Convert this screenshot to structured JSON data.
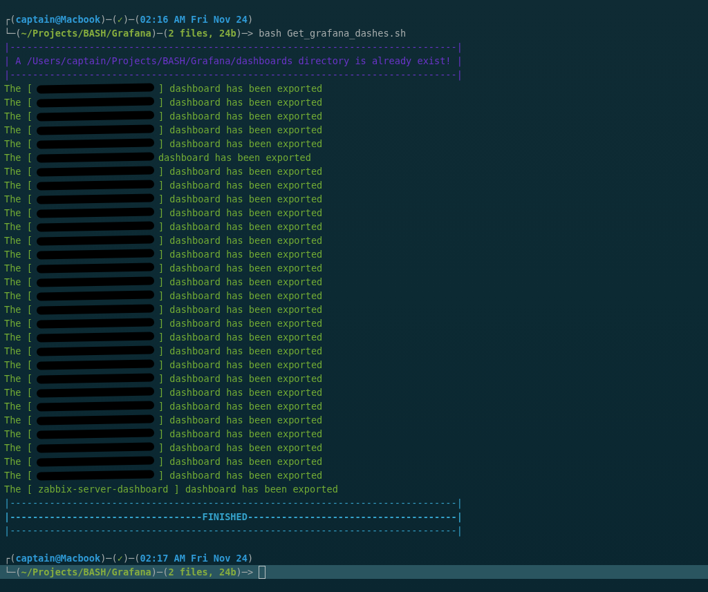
{
  "prompts": [
    {
      "line_1": [
        {
          "kind": "punct",
          "text": "┌("
        },
        {
          "kind": "host",
          "text": "captain@Macbook"
        },
        {
          "kind": "punct",
          "text": ")─("
        },
        {
          "kind": "status",
          "text": "✓"
        },
        {
          "kind": "punct",
          "text": ")─("
        },
        {
          "kind": "host",
          "text": "02:16 AM Fri Nov 24"
        },
        {
          "kind": "punct",
          "text": ")"
        }
      ],
      "line_2": [
        {
          "kind": "punct",
          "text": "└─("
        },
        {
          "kind": "path",
          "text": "~/Projects/BASH/Grafana"
        },
        {
          "kind": "punct",
          "text": ")─("
        },
        {
          "kind": "path",
          "text": "2 files, 24b"
        },
        {
          "kind": "punct",
          "text": ")─>"
        },
        {
          "kind": "command",
          "text": " bash Get_grafana_dashes.sh"
        }
      ]
    }
  ],
  "notice_box": {
    "border_top": "|-------------------------------------------------------------------------------|",
    "message": "| A /Users/captain/Projects/BASH/Grafana/dashboards directory is already exist! |",
    "border_bottom": "|-------------------------------------------------------------------------------|"
  },
  "exports": [
    {
      "before": "The [",
      "redacted": true,
      "after": "] dashboard has been exported"
    },
    {
      "before": "The [",
      "redacted": true,
      "after": "] dashboard has been exported"
    },
    {
      "before": "The [",
      "redacted": true,
      "after": "] dashboard has been exported"
    },
    {
      "before": "The [",
      "redacted": true,
      "after": "] dashboard has been exported"
    },
    {
      "before": "The [",
      "redacted": true,
      "after": "] dashboard has been exported"
    },
    {
      "before": "The [",
      "redacted": true,
      "after": "dashboard has been exported"
    },
    {
      "before": "The [",
      "redacted": true,
      "after": "] dashboard has been exported"
    },
    {
      "before": "The [",
      "redacted": true,
      "after": "] dashboard has been exported"
    },
    {
      "before": "The [",
      "redacted": true,
      "after": "] dashboard has been exported"
    },
    {
      "before": "The [",
      "redacted": true,
      "after": "] dashboard has been exported"
    },
    {
      "before": "The [",
      "redacted": true,
      "after": "] dashboard has been exported"
    },
    {
      "before": "The [",
      "redacted": true,
      "after": "] dashboard has been exported"
    },
    {
      "before": "The [",
      "redacted": true,
      "after": "] dashboard has been exported"
    },
    {
      "before": "The [",
      "redacted": true,
      "after": "] dashboard has been exported"
    },
    {
      "before": "The [",
      "redacted": true,
      "after": "] dashboard has been exported"
    },
    {
      "before": "The [",
      "redacted": true,
      "after": "] dashboard has been exported"
    },
    {
      "before": "The [",
      "redacted": true,
      "after": "] dashboard has been exported"
    },
    {
      "before": "The [",
      "redacted": true,
      "after": "] dashboard has been exported"
    },
    {
      "before": "The [",
      "redacted": true,
      "after": "] dashboard has been exported"
    },
    {
      "before": "The [",
      "redacted": true,
      "after": "] dashboard has been exported"
    },
    {
      "before": "The [",
      "redacted": true,
      "after": "] dashboard has been exported"
    },
    {
      "before": "The [",
      "redacted": true,
      "after": "] dashboard has been exported"
    },
    {
      "before": "The [",
      "redacted": true,
      "after": "] dashboard has been exported"
    },
    {
      "before": "The [",
      "redacted": true,
      "after": "] dashboard has been exported"
    },
    {
      "before": "The [",
      "redacted": true,
      "after": "] dashboard has been exported"
    },
    {
      "before": "The [",
      "redacted": true,
      "after": "] dashboard has been exported"
    },
    {
      "before": "The [",
      "redacted": true,
      "after": "] dashboard has been exported"
    },
    {
      "before": "The [",
      "redacted": true,
      "after": "] dashboard has been exported"
    },
    {
      "before": "The [",
      "redacted": true,
      "after": "] dashboard has been exported"
    },
    {
      "before": "The [",
      "redacted": false,
      "name": "zabbix-server-dashboard",
      "after": "] dashboard has been exported"
    }
  ],
  "finished_box": {
    "border_top": "|-------------------------------------------------------------------------------|",
    "message": "|----------------------------------FINISHED-------------------------------------|",
    "border_bottom": "|-------------------------------------------------------------------------------|"
  },
  "final_prompt": {
    "line_1": [
      {
        "kind": "punct",
        "text": "┌("
      },
      {
        "kind": "host",
        "text": "captain@Macbook"
      },
      {
        "kind": "punct",
        "text": ")─("
      },
      {
        "kind": "status",
        "text": "✓"
      },
      {
        "kind": "punct",
        "text": ")─("
      },
      {
        "kind": "host",
        "text": "02:17 AM Fri Nov 24"
      },
      {
        "kind": "punct",
        "text": ")"
      }
    ],
    "line_2": [
      {
        "kind": "punct",
        "text": "└─("
      },
      {
        "kind": "path",
        "text": "~/Projects/BASH/Grafana"
      },
      {
        "kind": "punct",
        "text": ")─("
      },
      {
        "kind": "path",
        "text": "2 files, 24b"
      },
      {
        "kind": "punct",
        "text": ")─>"
      }
    ],
    "current_line": true,
    "cursor": true
  }
}
